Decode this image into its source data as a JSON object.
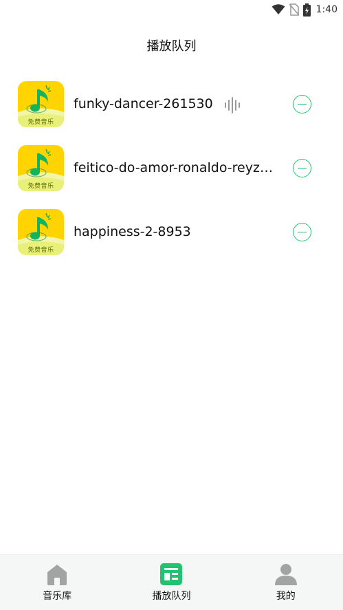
{
  "status_bar": {
    "time": "1:40",
    "icons": [
      "wifi-icon",
      "no-sim-icon",
      "battery-charging-icon"
    ]
  },
  "header": {
    "title": "播放队列"
  },
  "queue": {
    "items": [
      {
        "title": "funky-dancer-261530",
        "album_caption": "免费音乐",
        "playing": true
      },
      {
        "title": "feitico-do-amor-ronaldo-reyz-...",
        "album_caption": "免费音乐",
        "playing": false
      },
      {
        "title": "happiness-2-8953",
        "album_caption": "免费音乐",
        "playing": false
      }
    ]
  },
  "bottom_nav": {
    "items": [
      {
        "label": "音乐库",
        "icon": "home-icon",
        "active": false
      },
      {
        "label": "播放队列",
        "icon": "queue-list-icon",
        "active": true
      },
      {
        "label": "我的",
        "icon": "profile-icon",
        "active": false
      }
    ]
  },
  "colors": {
    "accent": "#22c36e",
    "album_yellow": "#ffd400",
    "inactive_icon": "#a3a3a3"
  }
}
